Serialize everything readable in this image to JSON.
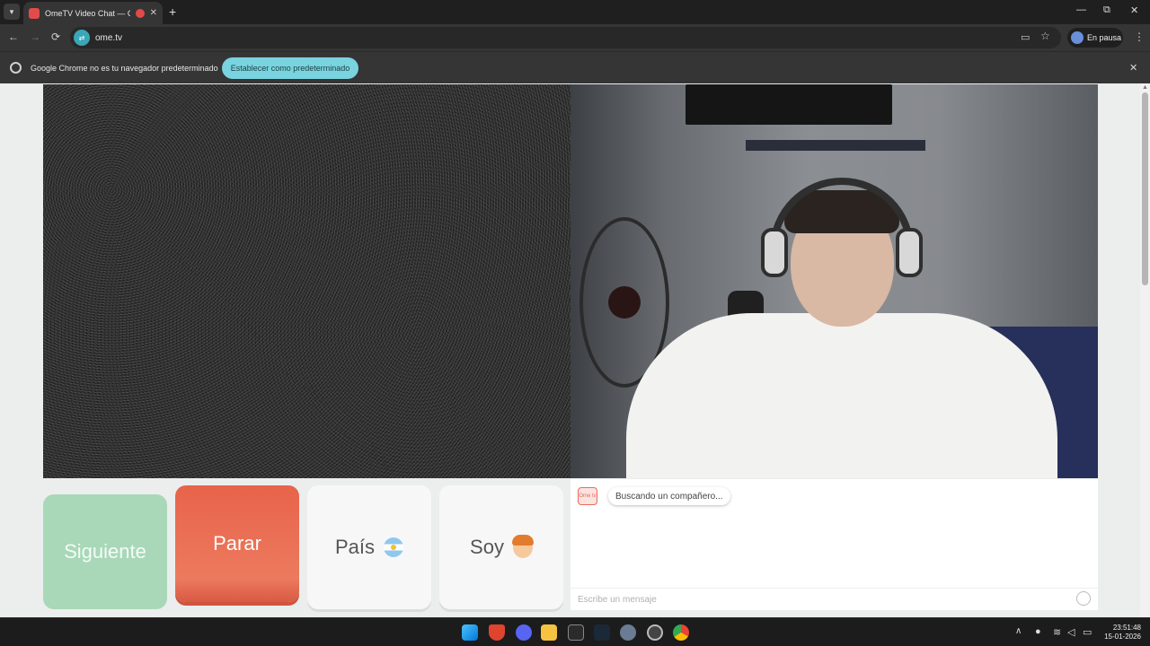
{
  "browser": {
    "tab_title": "OmeTV Video Chat — Ome",
    "url": "ome.tv",
    "profile_label": "En pausa",
    "new_tab": "+",
    "close": "✕",
    "minimize": "—",
    "maximize": "⧉",
    "window_close": "✕",
    "back": "←",
    "forward": "→",
    "reload": "⟳",
    "menu": "⋮"
  },
  "infobar": {
    "message": "Google Chrome no es tu navegador predeterminado",
    "button": "Establecer como predeterminado",
    "close": "✕"
  },
  "controls": {
    "next": "Siguiente",
    "stop": "Parar",
    "country": "País",
    "gender": "Soy"
  },
  "chat": {
    "logo": "Ome tv",
    "status": "Buscando un compañero...",
    "input_placeholder": "Escribe un mensaje"
  },
  "taskbar": {
    "time": "23:51:48",
    "date": "15-01-2026"
  },
  "colors": {
    "next": "#a8d8b8",
    "stop": "#e8634a",
    "accent": "#79d4df"
  },
  "icons": [
    "tab-list-icon",
    "favicon-icon",
    "recording-icon",
    "cast-icon",
    "star-icon",
    "chrome-icon",
    "flag-argentina-icon",
    "person-emoji-icon",
    "smile-icon",
    "windows-start-icon"
  ]
}
